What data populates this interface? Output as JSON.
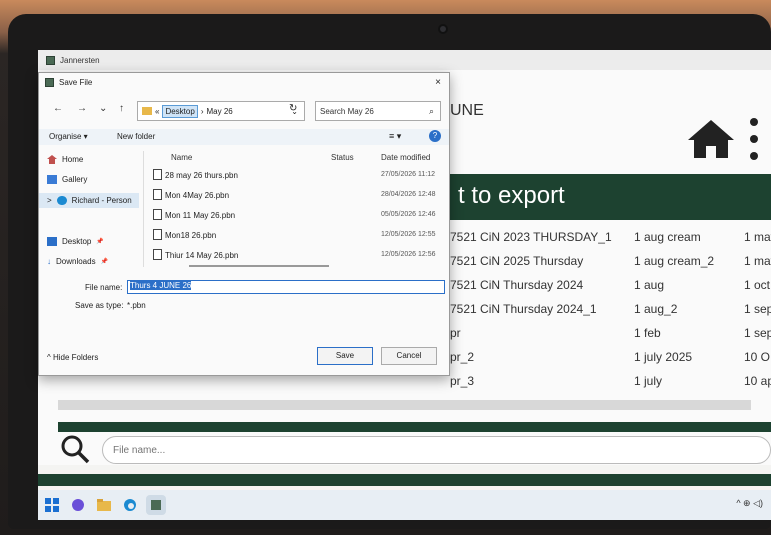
{
  "app": {
    "window_title": "Jannersten",
    "header_fragment": "UNE",
    "banner_title": "t to export"
  },
  "rows": [
    {
      "name": "7521 CiN 2023 THURSDAY_1",
      "col2": "1 aug cream",
      "col3": "1 may"
    },
    {
      "name": "7521 CiN 2025 Thursday",
      "col2": "1 aug cream_2",
      "col3": "1 may"
    },
    {
      "name": "7521 CiN Thursday 2024",
      "col2": "1 aug",
      "col3": "1 oct"
    },
    {
      "name": "7521 CiN Thursday 2024_1",
      "col2": "1 aug_2",
      "col3": "1 sep"
    },
    {
      "name": "pr",
      "col2": "1 feb",
      "col3": "1 sep"
    },
    {
      "name": "pr_2",
      "col2": "1 july 2025",
      "col3": "10 O"
    },
    {
      "name": "pr_3",
      "col2": "1 july",
      "col3": "10 ap"
    }
  ],
  "search": {
    "placeholder": "File name..."
  },
  "dialog": {
    "title": "Save File",
    "close": "×",
    "nav": {
      "back": "←",
      "forward": "→",
      "down": "⌄",
      "up": "↑"
    },
    "address": {
      "prefix": "«",
      "crumb1": "Desktop",
      "sep": "›",
      "crumb2": "May 26",
      "dropdown": "⌄"
    },
    "refresh": "↻",
    "search_placeholder": "Search May 26",
    "toolbar": {
      "organise": "Organise ▾",
      "new_folder": "New folder",
      "view": "≡ ▾",
      "help": "?"
    },
    "sidebar": [
      {
        "label": "Home"
      },
      {
        "label": "Gallery"
      },
      {
        "label": "Richard - Person"
      },
      {
        "label": "Desktop",
        "pin": "📌"
      },
      {
        "label": "Downloads",
        "pin": "📌"
      }
    ],
    "expand_arrow": ">",
    "columns": {
      "name": "Name",
      "status": "Status",
      "date": "Date modified"
    },
    "files": [
      {
        "name": "28 may 26 thurs.pbn",
        "date": "27/05/2026 11:12"
      },
      {
        "name": "Mon 4May 26.pbn",
        "date": "28/04/2026 12:48"
      },
      {
        "name": "Mon 11 May 26.pbn",
        "date": "05/05/2026 12:46"
      },
      {
        "name": "Mon18 26.pbn",
        "date": "12/05/2026 12:55"
      },
      {
        "name": "Thiur 14 May 26.pbn",
        "date": "12/05/2026 12:56"
      }
    ],
    "file_name_label": "File name:",
    "file_name_value": "Thurs 4 JUNE 26",
    "save_type_label": "Save as type:",
    "save_type_value": "*.pbn",
    "hide_folders": "^ Hide Folders",
    "save_label": "Save",
    "cancel_label": "Cancel"
  },
  "colors": {
    "brand_green": "#1d4230",
    "selection_blue": "#2b6fc8"
  }
}
